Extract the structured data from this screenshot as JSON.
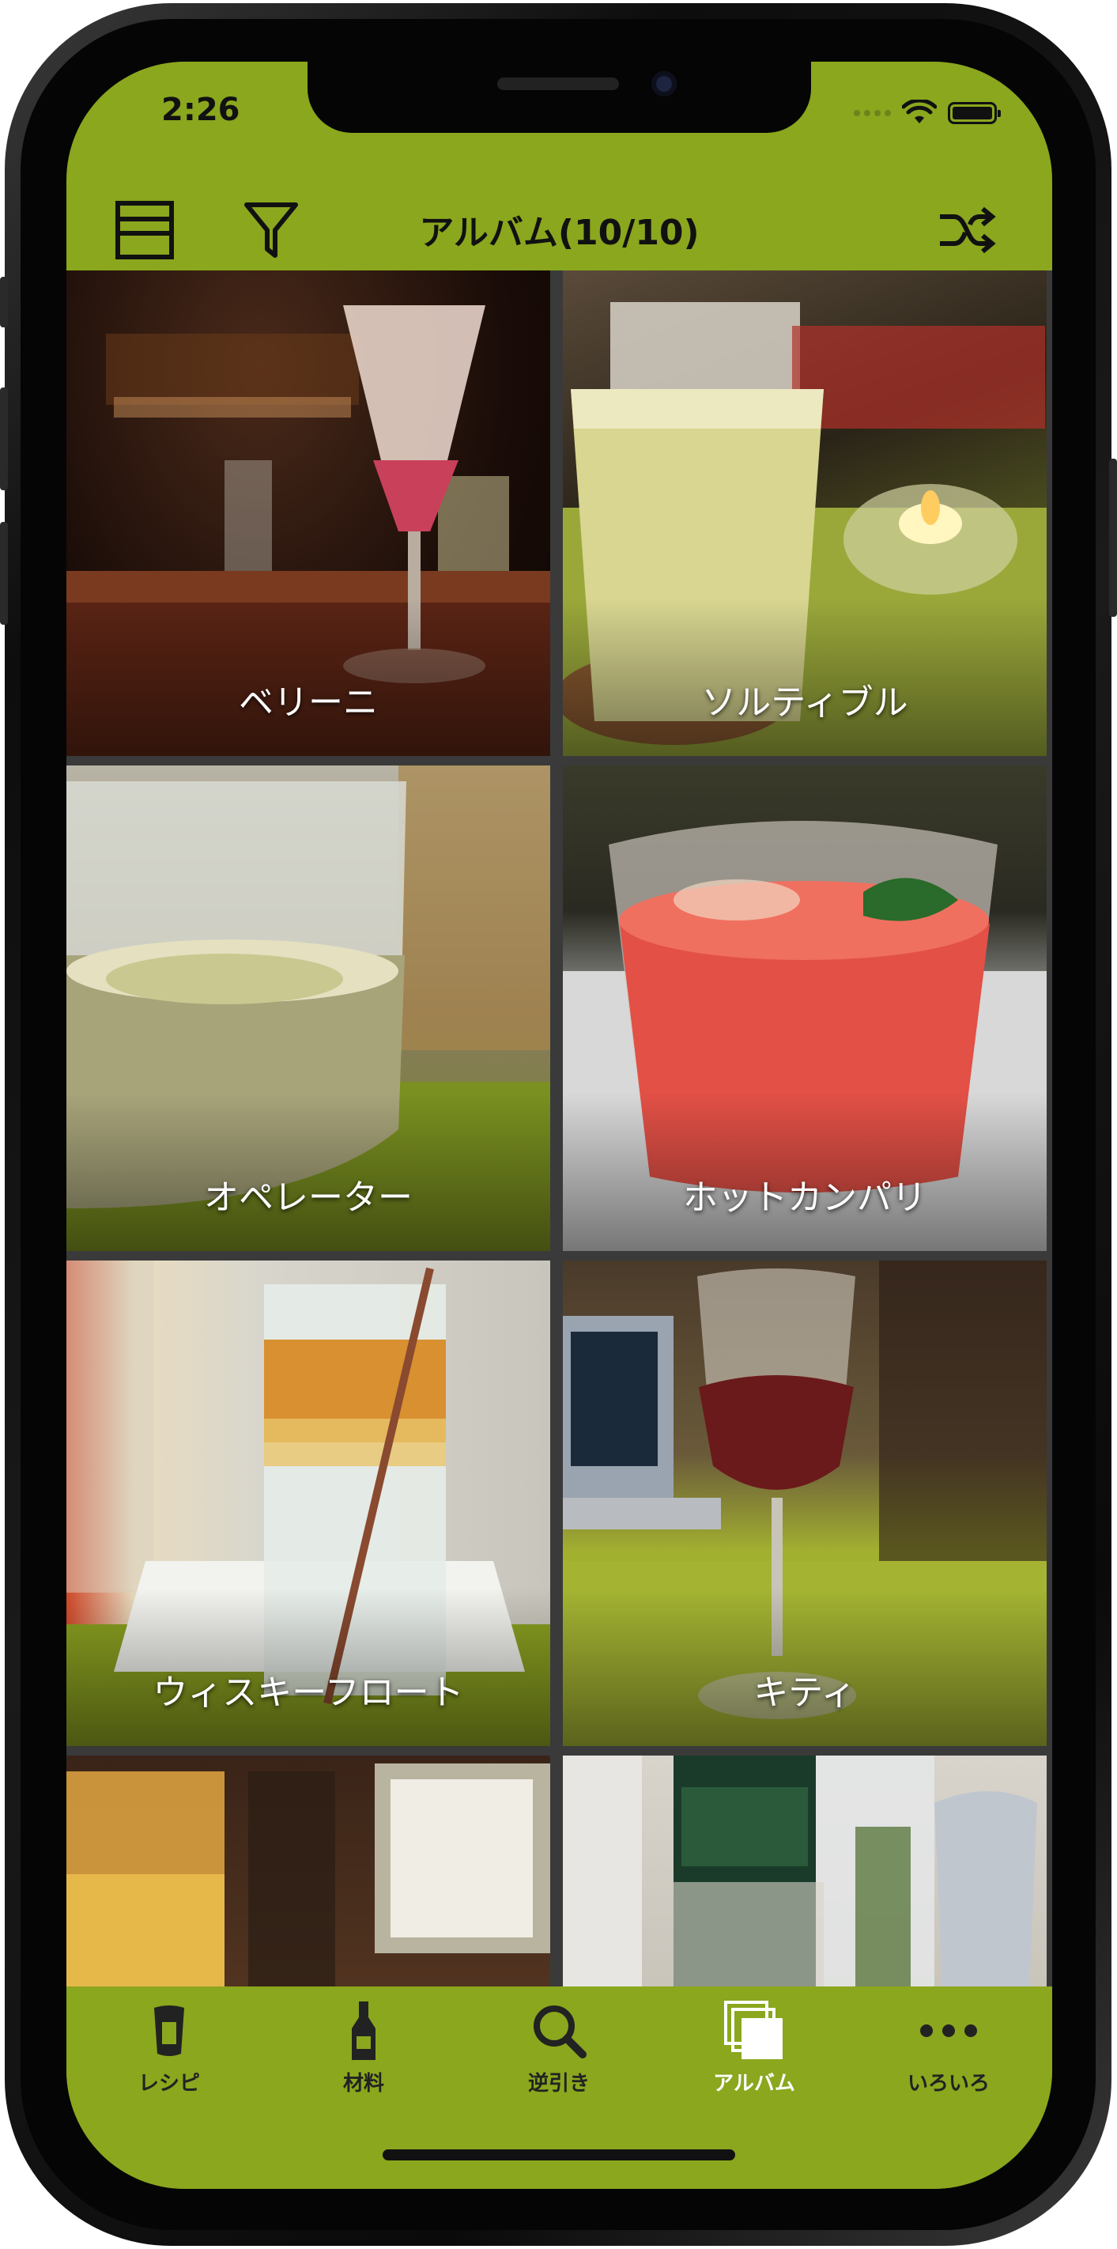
{
  "status": {
    "time": "2:26"
  },
  "navbar": {
    "title": "アルバム(10/10)"
  },
  "album": {
    "items": [
      {
        "name": "ベリーニ"
      },
      {
        "name": "ソルティブル"
      },
      {
        "name": "オペレーター"
      },
      {
        "name": "ホットカンパリ"
      },
      {
        "name": "ウィスキーフロート"
      },
      {
        "name": "キティ"
      },
      {
        "name": ""
      },
      {
        "name": ""
      }
    ]
  },
  "tabs": [
    {
      "label": "レシピ",
      "icon": "beer-glass-icon",
      "active": false
    },
    {
      "label": "材料",
      "icon": "bottle-icon",
      "active": false
    },
    {
      "label": "逆引き",
      "icon": "search-icon",
      "active": false
    },
    {
      "label": "アルバム",
      "icon": "album-icon",
      "active": true
    },
    {
      "label": "いろいろ",
      "icon": "more-icon",
      "active": false
    }
  ],
  "colors": {
    "accent": "#8aa71e",
    "active_tab": "#ffffff"
  }
}
